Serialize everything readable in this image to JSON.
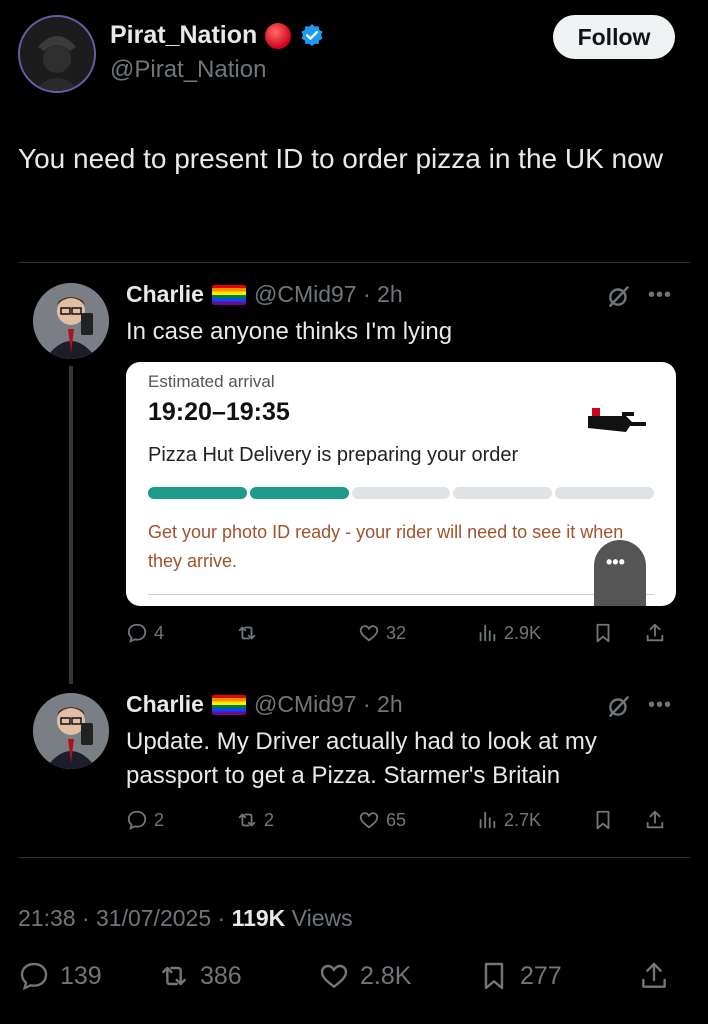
{
  "post": {
    "display_name": "Pirat_Nation",
    "handle": "@Pirat_Nation",
    "follow_label": "Follow",
    "text": "You need to present ID to order pizza in the UK now"
  },
  "replies": [
    {
      "name": "Charlie",
      "handle_time": "@CMid97 · 2h",
      "text": "In case anyone thinks I'm lying",
      "stats": {
        "replies": "4",
        "reposts": "",
        "likes": "32",
        "views": "2.9K"
      }
    },
    {
      "name": "Charlie",
      "handle_time": "@CMid97 · 2h",
      "text": "Update. My Driver actually had to look at my passport to get a Pizza. Starmer's Britain",
      "stats": {
        "replies": "2",
        "reposts": "2",
        "likes": "65",
        "views": "2.7K"
      }
    }
  ],
  "order_card": {
    "label": "Estimated arrival",
    "time": "19:20–19:35",
    "status": "Pizza Hut Delivery is preparing your order",
    "progress": 0.31,
    "warning": "Get your photo ID ready - your rider will need to see it when they arrive.",
    "more_label": "•••"
  },
  "meta": {
    "time_date": "21:38 · 31/07/2025 · ",
    "views_count": "119K",
    "views_label": " Views"
  },
  "engagement": {
    "replies": "139",
    "reposts": "386",
    "likes": "2.8K",
    "bookmarks": "277"
  },
  "colors": {
    "accent_teal": "#1e9a8a",
    "verified_blue": "#1d9bf0",
    "warning_text": "#a0522d"
  }
}
